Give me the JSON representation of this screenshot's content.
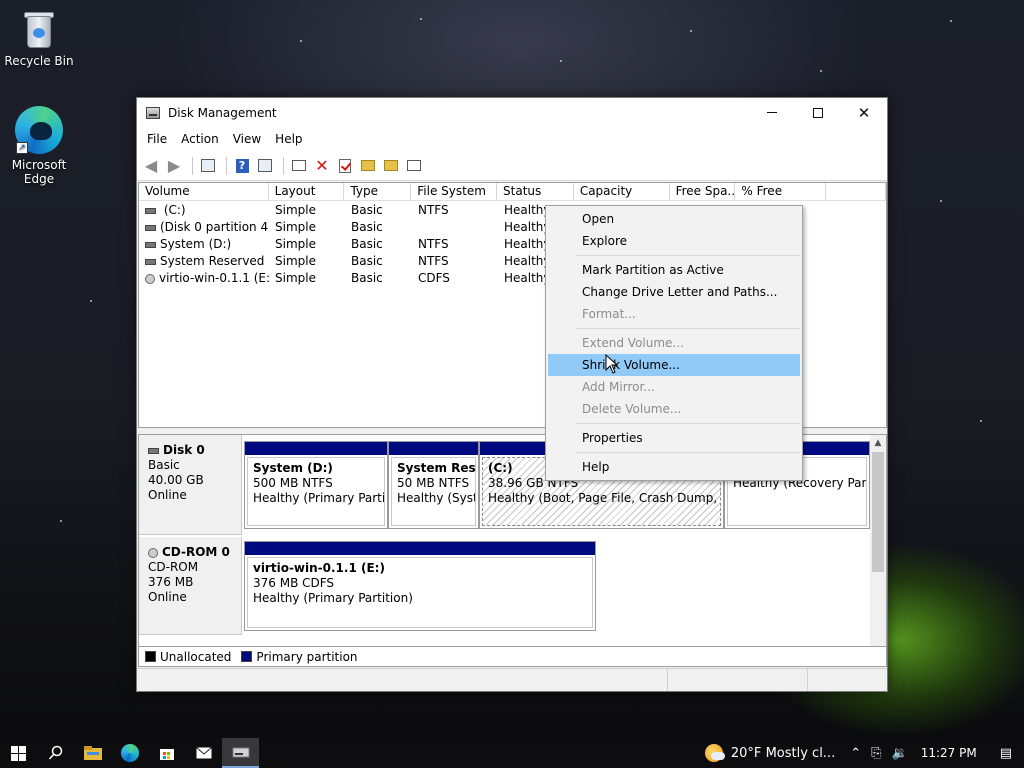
{
  "desktop": {
    "icons": [
      {
        "label": "Recycle Bin"
      },
      {
        "label": "Microsoft Edge"
      }
    ]
  },
  "window": {
    "title": "Disk Management",
    "controls": {
      "minimize": "—",
      "maximize": "☐",
      "close": "✕"
    }
  },
  "menubar": [
    "File",
    "Action",
    "View",
    "Help"
  ],
  "toolbar": {
    "icons": [
      "back-arrow-icon",
      "forward-arrow-icon",
      "show-hide-console-tree-icon",
      "help-icon",
      "console-view-icon",
      "connect-drive-icon",
      "delete-icon",
      "check-icon",
      "open-folder-icon",
      "search-folder-icon",
      "properties-icon"
    ]
  },
  "volumes": {
    "columns": [
      "Volume",
      "Layout",
      "Type",
      "File System",
      "Status",
      "Capacity",
      "Free Spa...",
      "% Free"
    ],
    "rows": [
      {
        "volume": " (C:)",
        "layout": "Simple",
        "type": "Basic",
        "fs": "NTFS",
        "status": "Healthy",
        "icon": "drive"
      },
      {
        "volume": "(Disk 0 partition 4)",
        "layout": "Simple",
        "type": "Basic",
        "fs": "",
        "status": "Healthy",
        "icon": "drive"
      },
      {
        "volume": "System (D:)",
        "layout": "Simple",
        "type": "Basic",
        "fs": "NTFS",
        "status": "Healthy",
        "icon": "drive"
      },
      {
        "volume": "System Reserved",
        "layout": "Simple",
        "type": "Basic",
        "fs": "NTFS",
        "status": "Healthy",
        "icon": "drive"
      },
      {
        "volume": "virtio-win-0.1.1 (E:)",
        "layout": "Simple",
        "type": "Basic",
        "fs": "CDFS",
        "status": "Healthy",
        "icon": "cdrom"
      }
    ]
  },
  "disks": [
    {
      "name": "Disk 0",
      "type": "Basic",
      "size": "40.00 GB",
      "state": "Online",
      "partitions": [
        {
          "name": "System  (D:)",
          "size": "500 MB NTFS",
          "status": "Healthy (Primary Partitic"
        },
        {
          "name": "System Reser",
          "size": "50 MB NTFS",
          "status": "Healthy (Syste"
        },
        {
          "name": " (C:)",
          "size": "38.96 GB NTFS",
          "status": "Healthy (Boot, Page File, Crash Dump, Prim"
        },
        {
          "name": "",
          "size": "509 MB",
          "status": "Healthy (Recovery Partiti"
        }
      ]
    },
    {
      "name": "CD-ROM 0",
      "type": "CD-ROM",
      "size": "376 MB",
      "state": "Online",
      "partitions": [
        {
          "name": "virtio-win-0.1.1  (E:)",
          "size": "376 MB CDFS",
          "status": "Healthy (Primary Partition)"
        }
      ]
    }
  ],
  "legend": [
    {
      "label": "Unallocated",
      "color": "#000000"
    },
    {
      "label": "Primary partition",
      "color": "#000a80"
    }
  ],
  "context_menu": {
    "items": [
      {
        "label": "Open",
        "disabled": false
      },
      {
        "label": "Explore",
        "disabled": false
      },
      {
        "label": "Mark Partition as Active",
        "disabled": false
      },
      {
        "label": "Change Drive Letter and Paths...",
        "disabled": false
      },
      {
        "label": "Format...",
        "disabled": true
      },
      {
        "label": "Extend Volume...",
        "disabled": true
      },
      {
        "label": "Shrink Volume...",
        "disabled": false,
        "highlighted": true
      },
      {
        "label": "Add Mirror...",
        "disabled": true
      },
      {
        "label": "Delete Volume...",
        "disabled": true
      },
      {
        "label": "Properties",
        "disabled": false
      },
      {
        "label": "Help",
        "disabled": false
      }
    ]
  },
  "taskbar": {
    "icons": [
      "windows-start-icon",
      "search-icon",
      "file-explorer-icon",
      "edge-icon",
      "store-icon",
      "mail-icon",
      "disk-management-icon"
    ],
    "weather": {
      "temp": "20°F",
      "summary": "Mostly cl..."
    },
    "clock": "11:27 PM"
  }
}
